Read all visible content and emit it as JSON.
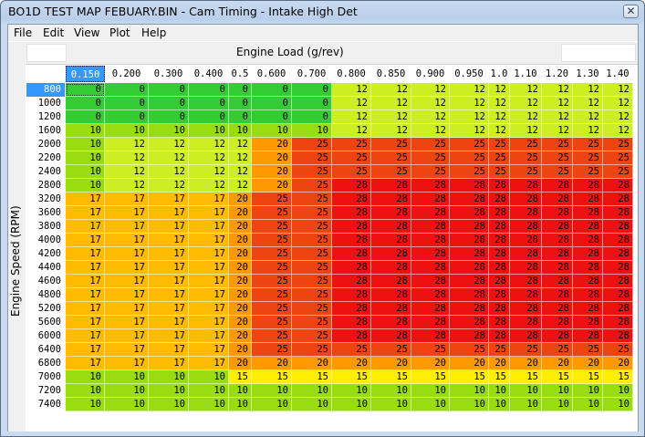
{
  "window": {
    "title": "BO1D TEST MAP FEBUARY.BIN - Cam Timing - Intake High Det",
    "close_glyph": "✕"
  },
  "menu": [
    "File",
    "Edit",
    "View",
    "Plot",
    "Help"
  ],
  "table": {
    "x_axis_title": "Engine Load (g/rev)",
    "y_axis_title": "Engine Speed (RPM)",
    "selected_col": 0,
    "selected_row": 0,
    "columns": [
      "0.150",
      "0.200",
      "0.300",
      "0.400",
      "0.5",
      "0.600",
      "0.700",
      "0.800",
      "0.850",
      "0.900",
      "0.950",
      "1.0",
      "1.10",
      "1.20",
      "1.30",
      "1.40"
    ],
    "rows": [
      {
        "rpm": "800",
        "values": [
          0,
          0,
          0,
          0,
          0,
          0,
          0,
          12,
          12,
          12,
          12,
          12,
          12,
          12,
          12,
          12
        ]
      },
      {
        "rpm": "1000",
        "values": [
          0,
          0,
          0,
          0,
          0,
          0,
          0,
          12,
          12,
          12,
          12,
          12,
          12,
          12,
          12,
          12
        ]
      },
      {
        "rpm": "1200",
        "values": [
          0,
          0,
          0,
          0,
          0,
          0,
          0,
          12,
          12,
          12,
          12,
          12,
          12,
          12,
          12,
          12
        ]
      },
      {
        "rpm": "1600",
        "values": [
          10,
          10,
          10,
          10,
          10,
          10,
          10,
          12,
          12,
          12,
          12,
          12,
          12,
          12,
          12,
          12
        ]
      },
      {
        "rpm": "2000",
        "values": [
          10,
          12,
          12,
          12,
          12,
          20,
          25,
          25,
          25,
          25,
          25,
          25,
          25,
          25,
          25,
          25
        ]
      },
      {
        "rpm": "2200",
        "values": [
          10,
          12,
          12,
          12,
          12,
          20,
          25,
          25,
          25,
          25,
          25,
          25,
          25,
          25,
          25,
          25
        ]
      },
      {
        "rpm": "2400",
        "values": [
          10,
          12,
          12,
          12,
          12,
          20,
          25,
          25,
          25,
          25,
          25,
          25,
          25,
          25,
          25,
          25
        ]
      },
      {
        "rpm": "2800",
        "values": [
          10,
          12,
          12,
          12,
          12,
          20,
          25,
          28,
          28,
          28,
          28,
          28,
          28,
          28,
          28,
          28
        ]
      },
      {
        "rpm": "3200",
        "values": [
          17,
          17,
          17,
          17,
          20,
          25,
          25,
          28,
          28,
          28,
          28,
          28,
          28,
          28,
          28,
          28
        ]
      },
      {
        "rpm": "3600",
        "values": [
          17,
          17,
          17,
          17,
          20,
          25,
          25,
          28,
          28,
          28,
          28,
          28,
          28,
          28,
          28,
          28
        ]
      },
      {
        "rpm": "3800",
        "values": [
          17,
          17,
          17,
          17,
          20,
          25,
          25,
          28,
          28,
          28,
          28,
          28,
          28,
          28,
          28,
          28
        ]
      },
      {
        "rpm": "4000",
        "values": [
          17,
          17,
          17,
          17,
          20,
          25,
          25,
          28,
          28,
          28,
          28,
          28,
          28,
          28,
          28,
          28
        ]
      },
      {
        "rpm": "4200",
        "values": [
          17,
          17,
          17,
          17,
          20,
          25,
          25,
          28,
          28,
          28,
          28,
          28,
          28,
          28,
          28,
          28
        ]
      },
      {
        "rpm": "4400",
        "values": [
          17,
          17,
          17,
          17,
          20,
          25,
          25,
          28,
          28,
          28,
          28,
          28,
          28,
          28,
          28,
          28
        ]
      },
      {
        "rpm": "4600",
        "values": [
          17,
          17,
          17,
          17,
          20,
          25,
          25,
          28,
          28,
          28,
          28,
          28,
          28,
          28,
          28,
          28
        ]
      },
      {
        "rpm": "4800",
        "values": [
          17,
          17,
          17,
          17,
          20,
          25,
          25,
          28,
          28,
          28,
          28,
          28,
          28,
          28,
          28,
          28
        ]
      },
      {
        "rpm": "5200",
        "values": [
          17,
          17,
          17,
          17,
          20,
          25,
          25,
          28,
          28,
          28,
          28,
          28,
          28,
          28,
          28,
          28
        ]
      },
      {
        "rpm": "5600",
        "values": [
          17,
          17,
          17,
          17,
          20,
          25,
          25,
          28,
          28,
          28,
          28,
          28,
          28,
          28,
          28,
          28
        ]
      },
      {
        "rpm": "6000",
        "values": [
          17,
          17,
          17,
          17,
          20,
          25,
          25,
          28,
          28,
          28,
          28,
          28,
          28,
          28,
          28,
          28
        ]
      },
      {
        "rpm": "6400",
        "values": [
          17,
          17,
          17,
          17,
          20,
          25,
          25,
          25,
          25,
          25,
          25,
          25,
          25,
          25,
          25,
          25
        ]
      },
      {
        "rpm": "6800",
        "values": [
          17,
          17,
          17,
          17,
          20,
          20,
          20,
          20,
          20,
          20,
          20,
          20,
          20,
          20,
          20,
          20
        ]
      },
      {
        "rpm": "7000",
        "values": [
          10,
          10,
          10,
          10,
          15,
          15,
          15,
          15,
          15,
          15,
          15,
          15,
          15,
          15,
          15,
          15
        ]
      },
      {
        "rpm": "7200",
        "values": [
          10,
          10,
          10,
          10,
          10,
          10,
          10,
          10,
          10,
          10,
          10,
          10,
          10,
          10,
          10,
          10
        ]
      },
      {
        "rpm": "7400",
        "values": [
          10,
          10,
          10,
          10,
          10,
          10,
          10,
          10,
          10,
          10,
          10,
          10,
          10,
          10,
          10,
          10
        ]
      }
    ]
  },
  "value_colors": {
    "0": "#33cc33",
    "10": "#99dd11",
    "12": "#ccee22",
    "15": "#ffee00",
    "17": "#ffbb00",
    "20": "#ff9900",
    "25": "#ee4411",
    "28": "#ee1111"
  }
}
